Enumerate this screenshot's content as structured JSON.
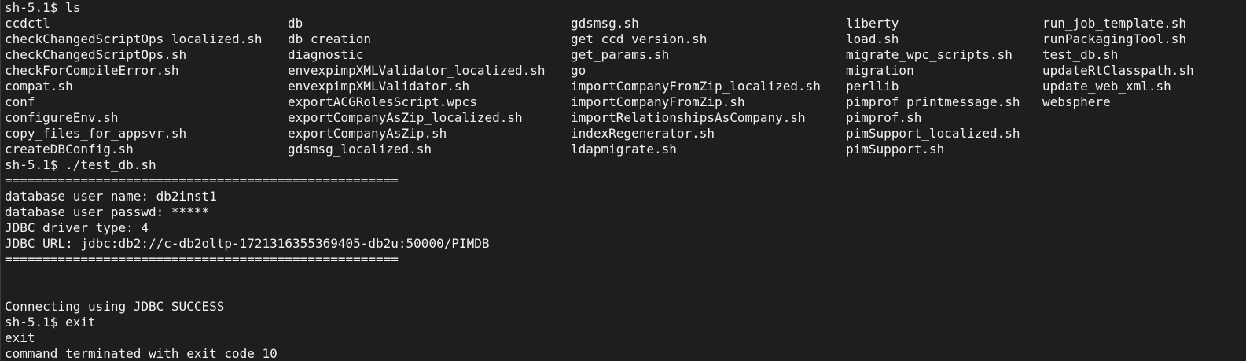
{
  "terminal": {
    "cmd_ls": "sh-5.1$ ls",
    "ls_columns": [
      [
        "ccdctl",
        "checkChangedScriptOps_localized.sh",
        "checkChangedScriptOps.sh",
        "checkForCompileError.sh",
        "compat.sh",
        "conf",
        "configureEnv.sh",
        "copy_files_for_appsvr.sh",
        "createDBConfig.sh"
      ],
      [
        "db",
        "db_creation",
        "diagnostic",
        "envexpimpXMLValidator_localized.sh",
        "envexpimpXMLValidator.sh",
        "exportACGRolesScript.wpcs",
        "exportCompanyAsZip_localized.sh",
        "exportCompanyAsZip.sh",
        "gdsmsg_localized.sh"
      ],
      [
        "gdsmsg.sh",
        "get_ccd_version.sh",
        "get_params.sh",
        "go",
        "importCompanyFromZip_localized.sh",
        "importCompanyFromZip.sh",
        "importRelationshipsAsCompany.sh",
        "indexRegenerator.sh",
        "ldapmigrate.sh"
      ],
      [
        "liberty",
        "load.sh",
        "migrate_wpc_scripts.sh",
        "migration",
        "perllib",
        "pimprof_printmessage.sh",
        "pimprof.sh",
        "pimSupport_localized.sh",
        "pimSupport.sh"
      ],
      [
        "run_job_template.sh",
        "runPackagingTool.sh",
        "test_db.sh",
        "updateRtClasspath.sh",
        "update_web_xml.sh",
        "websphere"
      ]
    ],
    "cmd_test": "sh-5.1$ ./test_db.sh",
    "separator": "====================================================",
    "db_user": "database user name: db2inst1",
    "db_passwd": "database user passwd: *****",
    "jdbc_driver": "JDBC driver type: 4",
    "jdbc_url": "JDBC URL: jdbc:db2://c-db2oltp-1721316355369405-db2u:50000/PIMDB",
    "separator2": "====================================================",
    "connecting": "Connecting using JDBC SUCCESS",
    "cmd_exit": "sh-5.1$ exit",
    "exit_echo": "exit",
    "terminated": "command terminated with exit code 10"
  }
}
